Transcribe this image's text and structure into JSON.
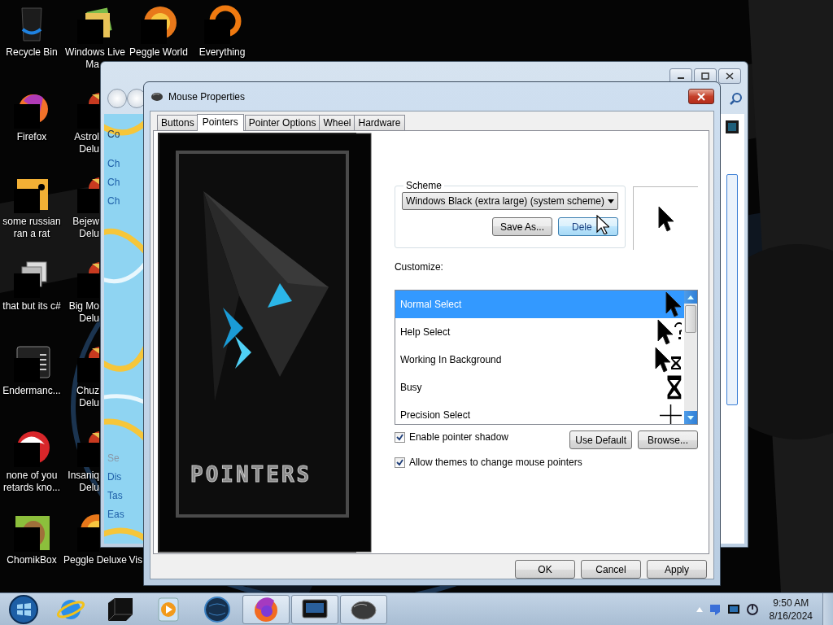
{
  "desktop_icons": [
    {
      "kind": "bin",
      "lines": [
        {
          "text": "Recycle Bin",
          "cut": false
        }
      ]
    },
    {
      "kind": "folder",
      "lines": [
        {
          "text": "Windows Live",
          "cut": false
        },
        {
          "text": "Ma",
          "cut": true
        }
      ]
    },
    {
      "kind": "ball",
      "lines": [
        {
          "text": "Peggle World",
          "cut": false
        }
      ]
    },
    {
      "kind": "ring",
      "lines": [
        {
          "text": "Everything",
          "cut": false
        }
      ]
    },
    {
      "kind": "fox",
      "lines": [
        {
          "text": "Firefox",
          "cut": false
        }
      ]
    },
    {
      "kind": "game",
      "lines": [
        {
          "text": "Astrol",
          "cut": true
        },
        {
          "text": "Delu",
          "cut": true
        }
      ]
    },
    {
      "kind": "note",
      "lines": [
        {
          "text": "some russian",
          "cut": false
        },
        {
          "text": "ran a rat",
          "cut": false
        }
      ]
    },
    {
      "kind": "game",
      "lines": [
        {
          "text": "Bejew",
          "cut": true
        },
        {
          "text": "Delu",
          "cut": true
        }
      ]
    },
    {
      "kind": "stack",
      "lines": [
        {
          "text": "that but its c#",
          "cut": false
        }
      ]
    },
    {
      "kind": "game",
      "lines": [
        {
          "text": "Big Mo",
          "cut": true
        },
        {
          "text": "Delu",
          "cut": true
        }
      ]
    },
    {
      "kind": "console",
      "lines": [
        {
          "text": "Endermanc...",
          "cut": false
        }
      ]
    },
    {
      "kind": "game",
      "lines": [
        {
          "text": "Chuz",
          "cut": true
        },
        {
          "text": "Delu",
          "cut": true
        }
      ]
    },
    {
      "kind": "swirl",
      "lines": [
        {
          "text": "none of you",
          "cut": false
        },
        {
          "text": "retards kno...",
          "cut": false
        }
      ]
    },
    {
      "kind": "game",
      "lines": [
        {
          "text": "Insaniq",
          "cut": true
        },
        {
          "text": "Delu",
          "cut": true
        }
      ]
    },
    {
      "kind": "hamster",
      "lines": [
        {
          "text": "ChomikBox",
          "cut": false
        }
      ]
    },
    {
      "kind": "ball",
      "lines": [
        {
          "text": "Peggle Deluxe",
          "cut": false
        }
      ]
    },
    {
      "lines": [
        {
          "text": "Vis",
          "cut": true
        }
      ]
    }
  ],
  "background_window": {
    "side_links": [
      {
        "text": "Co",
        "kind": "home"
      },
      {
        "text": "Ch",
        "kind": "link"
      },
      {
        "text": "Ch",
        "kind": "link"
      },
      {
        "text": "Ch",
        "kind": "link"
      }
    ],
    "see_also": [
      {
        "text": "Se",
        "kind": "heading"
      },
      {
        "text": "Dis",
        "kind": "link"
      },
      {
        "text": "Tas",
        "kind": "link"
      },
      {
        "text": "Eas",
        "kind": "link"
      }
    ]
  },
  "dialog": {
    "title": "Mouse Properties",
    "tabs": [
      {
        "label": "Buttons",
        "selected": false
      },
      {
        "label": "Pointers",
        "selected": true
      },
      {
        "label": "Pointer Options",
        "selected": false
      },
      {
        "label": "Wheel",
        "selected": false
      },
      {
        "label": "Hardware",
        "selected": false
      }
    ],
    "banner_text": "POINTERS",
    "scheme": {
      "legend": "Scheme",
      "value": "Windows Black (extra large) (system scheme)",
      "buttons": [
        {
          "label": "Save As...",
          "hovered": false
        },
        {
          "label": "Dele",
          "hovered": true
        }
      ]
    },
    "customize_label": "Customize:",
    "pointers": [
      {
        "name": "Normal Select",
        "kind": "arrow",
        "selected": true
      },
      {
        "name": "Help Select",
        "kind": "help",
        "selected": false
      },
      {
        "name": "Working In Background",
        "kind": "working",
        "selected": false
      },
      {
        "name": "Busy",
        "kind": "busy",
        "selected": false
      },
      {
        "name": "Precision Select",
        "kind": "precision",
        "selected": false
      }
    ],
    "options": [
      {
        "label": "Enable pointer shadow",
        "checked": true
      },
      {
        "label": "Allow themes to change mouse pointers",
        "checked": true
      }
    ],
    "list_buttons": [
      "Use Default",
      "Browse..."
    ],
    "buttons": [
      "OK",
      "Cancel",
      "Apply"
    ]
  },
  "taskbar": {
    "items": [
      {
        "kind": "ie",
        "running": false
      },
      {
        "kind": "box",
        "running": false
      },
      {
        "kind": "media",
        "running": false
      },
      {
        "kind": "globe",
        "running": false
      },
      {
        "kind": "firefox",
        "running": true
      },
      {
        "kind": "window",
        "running": true
      },
      {
        "kind": "mouse",
        "running": true
      }
    ],
    "time": "9:50 AM",
    "date": "8/16/2024"
  }
}
